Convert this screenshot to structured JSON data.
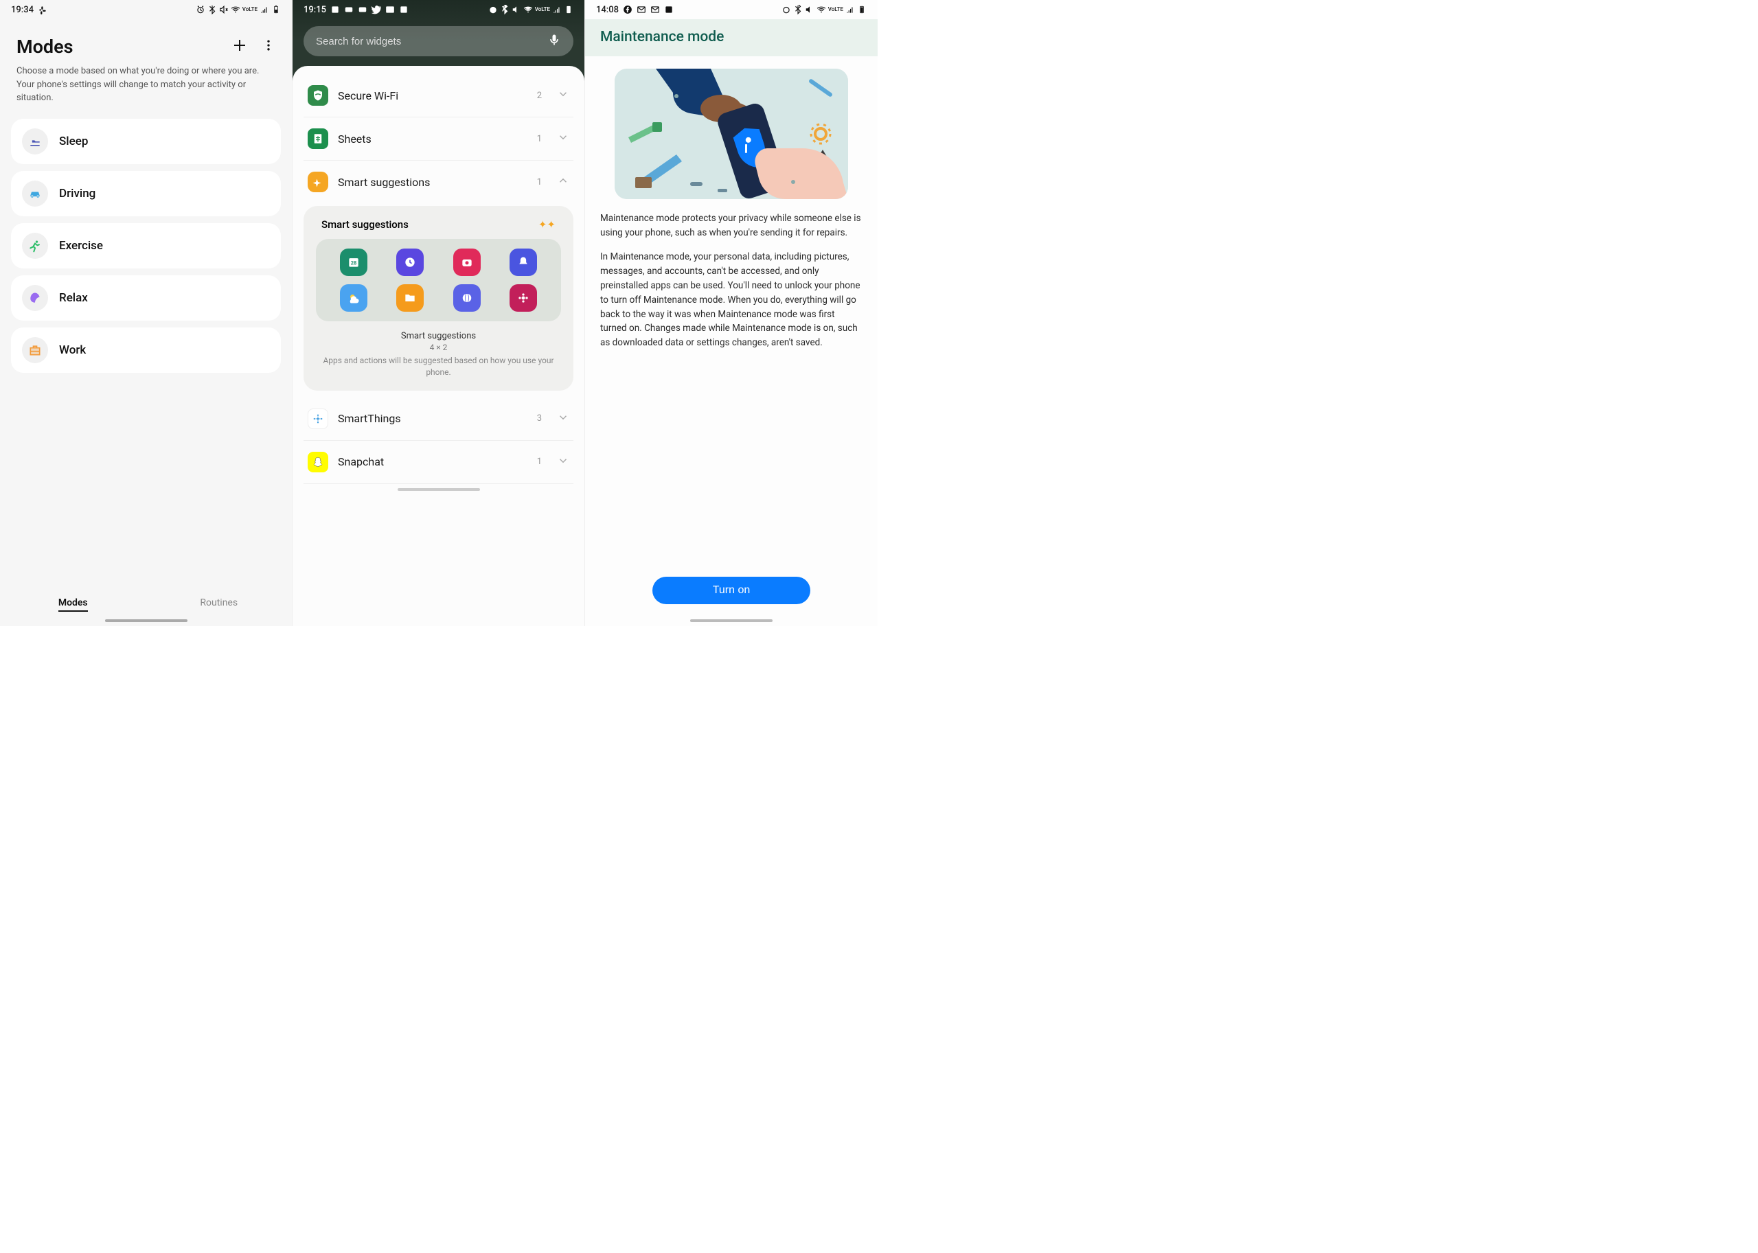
{
  "p1": {
    "status": {
      "time": "19:34",
      "lte": "VoLTE"
    },
    "title": "Modes",
    "subtitle": "Choose a mode based on what you're doing or where you are. Your phone's settings will change to match your activity or situation.",
    "modes": [
      {
        "label": "Sleep",
        "icon": "bed-icon",
        "color": "#4a55b5"
      },
      {
        "label": "Driving",
        "icon": "car-icon",
        "color": "#3fa7e0"
      },
      {
        "label": "Exercise",
        "icon": "running-icon",
        "color": "#2fbe6a"
      },
      {
        "label": "Relax",
        "icon": "leaf-icon",
        "color": "#9a6cf0"
      },
      {
        "label": "Work",
        "icon": "briefcase-icon",
        "color": "#f29a3a"
      }
    ],
    "tabs": {
      "active": "Modes",
      "inactive": "Routines"
    }
  },
  "p2": {
    "status": {
      "time": "19:15",
      "lte": "VoLTE"
    },
    "search_placeholder": "Search for widgets",
    "items": [
      {
        "label": "Secure Wi-Fi",
        "count": "2",
        "expanded": false,
        "icon_bg": "#2f8b4a"
      },
      {
        "label": "Sheets",
        "count": "1",
        "expanded": false,
        "icon_bg": "#1c8f4d"
      },
      {
        "label": "Smart suggestions",
        "count": "1",
        "expanded": true,
        "icon_bg": "#f5a623"
      },
      {
        "label": "SmartThings",
        "count": "3",
        "expanded": false,
        "icon_bg": "#ffffff"
      },
      {
        "label": "Snapchat",
        "count": "1",
        "expanded": false,
        "icon_bg": "#fffc00"
      }
    ],
    "expanded_card": {
      "title": "Smart suggestions",
      "caption_label": "Smart suggestions",
      "dimensions": "4 × 2",
      "description": "Apps and actions will be suggested based on how you use your phone.",
      "preview_apps": [
        {
          "bg": "#1b8e6c",
          "icon": "calendar"
        },
        {
          "bg": "#5a47e0",
          "icon": "clock"
        },
        {
          "bg": "#e02a5a",
          "icon": "camera"
        },
        {
          "bg": "#4a55e0",
          "icon": "bell"
        },
        {
          "bg": "#4aa3f0",
          "icon": "weather"
        },
        {
          "bg": "#f59b1c",
          "icon": "folder"
        },
        {
          "bg": "#5a62e6",
          "icon": "browser"
        },
        {
          "bg": "#c21f5a",
          "icon": "gallery"
        }
      ]
    }
  },
  "p3": {
    "status": {
      "time": "14:08",
      "lte": "VoLTE"
    },
    "title": "Maintenance mode",
    "para1": "Maintenance mode protects your privacy while someone else is using your phone, such as when you're sending it for repairs.",
    "para2": "In Maintenance mode, your personal data, including pictures, messages, and accounts, can't be accessed, and only preinstalled apps can be used. You'll need to unlock your phone to turn off Maintenance mode. When you do, everything will go back to the way it was when Maintenance mode was first turned on. Changes made while Maintenance mode is on, such as downloaded data or settings changes, aren't saved.",
    "cta": "Turn on"
  }
}
